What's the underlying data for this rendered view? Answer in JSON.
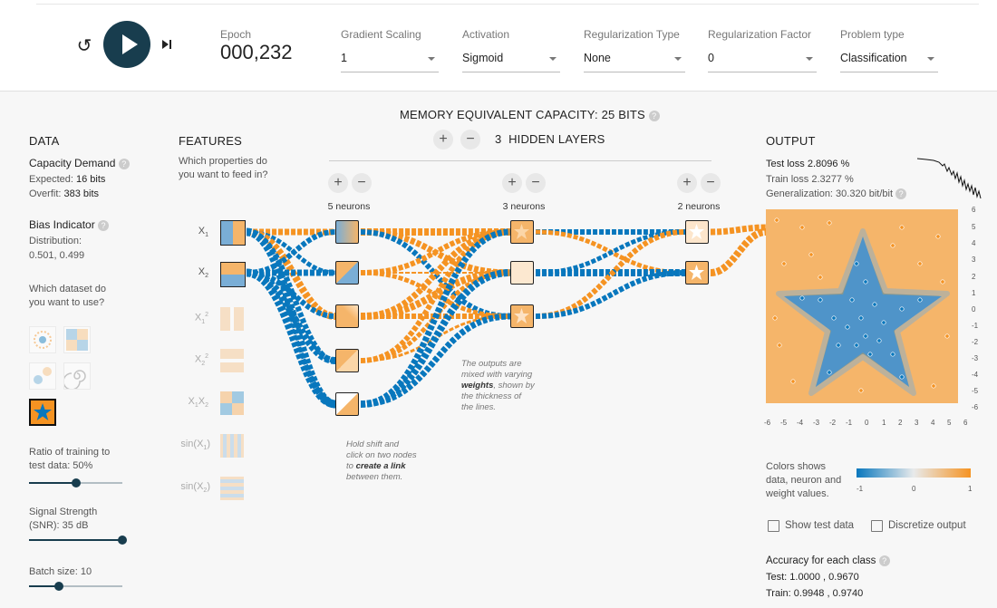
{
  "controls": {
    "epoch_label": "Epoch",
    "epoch_value": "000,232",
    "gradient_scaling": {
      "label": "Gradient Scaling",
      "value": "1"
    },
    "activation": {
      "label": "Activation",
      "value": "Sigmoid"
    },
    "regularization_type": {
      "label": "Regularization Type",
      "value": "None"
    },
    "regularization_factor": {
      "label": "Regularization Factor",
      "value": "0"
    },
    "problem_type": {
      "label": "Problem type",
      "value": "Classification"
    }
  },
  "capacity_title": "MEMORY EQUIVALENT CAPACITY: 25 BITS",
  "data": {
    "title": "DATA",
    "capacity_demand": "Capacity Demand",
    "expected_label": "Expected:",
    "expected_value": "16 bits",
    "overfit_label": "Overfit:",
    "overfit_value": "383 bits",
    "bias_indicator": "Bias Indicator",
    "distribution_label": "Distribution:",
    "distribution_value": "0.501, 0.499",
    "dataset_question_1": "Which dataset do",
    "dataset_question_2": "you want to use?",
    "ratio_label_1": "Ratio of training to",
    "ratio_label_2": "test data:  50%",
    "ratio_value": 0.5,
    "signal_label_1": "Signal Strength",
    "signal_label_2": "(SNR):  35 dB",
    "signal_value": 1.0,
    "batch_label": "Batch size:  10",
    "batch_value": 0.3
  },
  "features": {
    "title": "FEATURES",
    "question_1": "Which properties do",
    "question_2": "you want to feed in?",
    "items": [
      {
        "label": "X",
        "sub": "1",
        "sup": ""
      },
      {
        "label": "X",
        "sub": "2",
        "sup": ""
      },
      {
        "label": "X",
        "sub": "1",
        "sup": "2"
      },
      {
        "label": "X",
        "sub": "2",
        "sup": "2"
      },
      {
        "label": "X",
        "sub": "1",
        "mid": "X",
        "sub2": "2"
      },
      {
        "label": "sin(X",
        "sub": "1",
        "tail": ")"
      },
      {
        "label": "sin(X",
        "sub": "2",
        "tail": ")"
      }
    ]
  },
  "network": {
    "plus": "+",
    "minus": "−",
    "layers_count": "3",
    "layers_label": "HIDDEN LAYERS",
    "layer_labels": [
      "5 neurons",
      "3 neurons",
      "2 neurons"
    ],
    "note_link_1": "Hold shift and",
    "note_link_2": "click on two nodes",
    "note_link_3": "to",
    "note_link_bold": "create a link",
    "note_link_4": "between them.",
    "note_weights_1": "The outputs are",
    "note_weights_2": "mixed with varying",
    "note_weights_bold": "weights",
    "note_weights_3": ", shown by",
    "note_weights_4": "the thickness of",
    "note_weights_5": "the lines."
  },
  "output": {
    "title": "OUTPUT",
    "test_loss": "Test loss 2.8096 %",
    "train_loss": "Train loss 2.3277 %",
    "generalization": "Generalization: 30.320 bit/bit",
    "y_ticks": [
      "6",
      "5",
      "4",
      "3",
      "2",
      "1",
      "0",
      "-1",
      "-2",
      "-3",
      "-4",
      "-5",
      "-6"
    ],
    "x_ticks": [
      "-6",
      "-5",
      "-4",
      "-3",
      "-2",
      "-1",
      "0",
      "1",
      "2",
      "3",
      "4",
      "5",
      "6"
    ],
    "colors_1": "Colors shows",
    "colors_2": "data, neuron and",
    "colors_3": "weight values.",
    "scale_min": "-1",
    "scale_mid": "0",
    "scale_max": "1",
    "show_test": "Show test data",
    "discretize": "Discretize output",
    "accuracy_title": "Accuracy for each class",
    "accuracy_test": "Test: 1.0000 , 0.9670",
    "accuracy_train": "Train: 0.9948 , 0.9740"
  },
  "colors": {
    "orange": "#f59322",
    "blue": "#0877bd",
    "navy": "#183d4e"
  }
}
